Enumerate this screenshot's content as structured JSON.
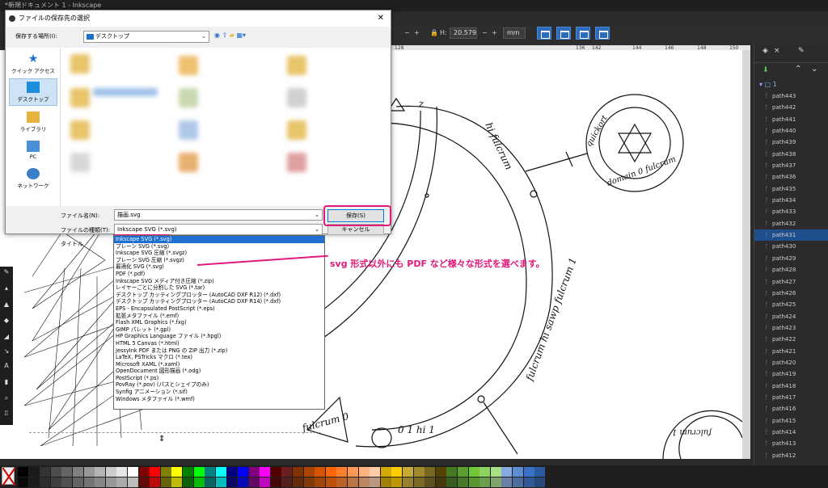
{
  "window_title": "*新規ドキュメント 1 - Inkscape",
  "toolbar": {
    "h_label": "H:",
    "h_value": "20.579",
    "unit": "mm",
    "minus": "−",
    "plus": "+"
  },
  "ruler": {
    "ticks": [
      "128",
      "136",
      "142",
      "144",
      "146",
      "148",
      "150"
    ]
  },
  "right_panel": {
    "tab_close": "×",
    "root_label": "1",
    "layers": [
      "path443",
      "path442",
      "path441",
      "path440",
      "path439",
      "path438",
      "path437",
      "path436",
      "path435",
      "path434",
      "path433",
      "path432",
      "path431",
      "path430",
      "path429",
      "path428",
      "path427",
      "path426",
      "path425",
      "path424",
      "path423",
      "path422",
      "path421",
      "path420",
      "path419",
      "path418",
      "path417",
      "path416",
      "path415",
      "path414",
      "path413",
      "path412"
    ],
    "selected_layer": "path431"
  },
  "dialog": {
    "title": "ファイルの保存先の選択",
    "location_label": "保存する場所(I):",
    "location_value": "デスクトップ",
    "places": [
      "クイック アクセス",
      "デスクトップ",
      "ライブラリ",
      "PC",
      "ネットワーク"
    ],
    "filename_label": "ファイル名(N):",
    "filename_value": "描画.svg",
    "filetype_label": "ファイルの種類(T):",
    "filetype_value": "Inkscape SVG (*.svg)",
    "title_label": "タイトル",
    "save_button": "保存(S)",
    "cancel_button": "キャンセル"
  },
  "filetypes": [
    "Inkscape SVG (*.svg)",
    "プレーン SVG (*.svg)",
    "Inkscape SVG 圧縮 (*.svgz)",
    "プレーン SVG 圧縮 (*.svgz)",
    "最適化 SVG (*.svg)",
    "PDF (*.pdf)",
    "Inkscape SVG メディア付き圧縮 (*.zip)",
    "レイヤーごとに分割した SVG (*.tar)",
    "デスクトップ カッティングプロッター (AutoCAD DXF R12) (*.dxf)",
    "デスクトップ カッティングプロッター (AutoCAD DXF R14) (*.dxf)",
    "EPS - Encapsulated PostScript (*.eps)",
    "拡張メタファイル (*.emf)",
    "Flash XML Graphics (*.fxg)",
    "GIMP パレット (*.gpl)",
    "HP Graphics Language ファイル (*.hpgl)",
    "HTML 5 Canvas (*.html)",
    "JessyInk PDF または PNG の ZIP 出力 (*.zip)",
    "LaTeX, PSTricks マクロ (*.tex)",
    "Microsoft XAML (*.xaml)",
    "OpenDocument 図形描画 (*.odg)",
    "PostScript (*.ps)",
    "PovRay (*.pov) (パスとシェイプのみ)",
    "Synfig アニメーション (*.sif)",
    "Windows メタファイル (*.wmf)"
  ],
  "annotation": "svg 形式以外にも PDF など様々な形式を選べます。",
  "canvas": {
    "ring_text_1": "fulcrum 0",
    "ring_text_2": "0 1 hi 1",
    "ring_text_3": "fulcrum hi sawp fulcrum 1",
    "ring_text_4": "hi fulcrum",
    "ring_text_5": "quickort",
    "ring_text_6": "domain 0 fulcrum",
    "ring_text_7": "fulcrum 1",
    "ring_text_8": "z"
  },
  "palette": [
    "#000000",
    "#1a1a1a",
    "#333333",
    "#4d4d4d",
    "#666666",
    "#808080",
    "#999999",
    "#b3b3b3",
    "#cccccc",
    "#e6e6e6",
    "#ffffff",
    "#800000",
    "#ff0000",
    "#808000",
    "#ffff00",
    "#008000",
    "#00ff00",
    "#008080",
    "#00ffff",
    "#000080",
    "#0000ff",
    "#800080",
    "#ff00ff",
    "#550000",
    "#6b1f1f",
    "#803300",
    "#aa4400",
    "#d45500",
    "#ff6600",
    "#ff7f2a",
    "#ff9955",
    "#ffb380",
    "#ffccaa",
    "#d4aa00",
    "#ffcc00",
    "#c8ab37",
    "#a0892c",
    "#786721",
    "#554400",
    "#447821",
    "#5aa02c",
    "#71c837",
    "#8dd35f",
    "#aade87",
    "#87aade",
    "#5f8dd3",
    "#3771c8",
    "#2c5aa0"
  ]
}
